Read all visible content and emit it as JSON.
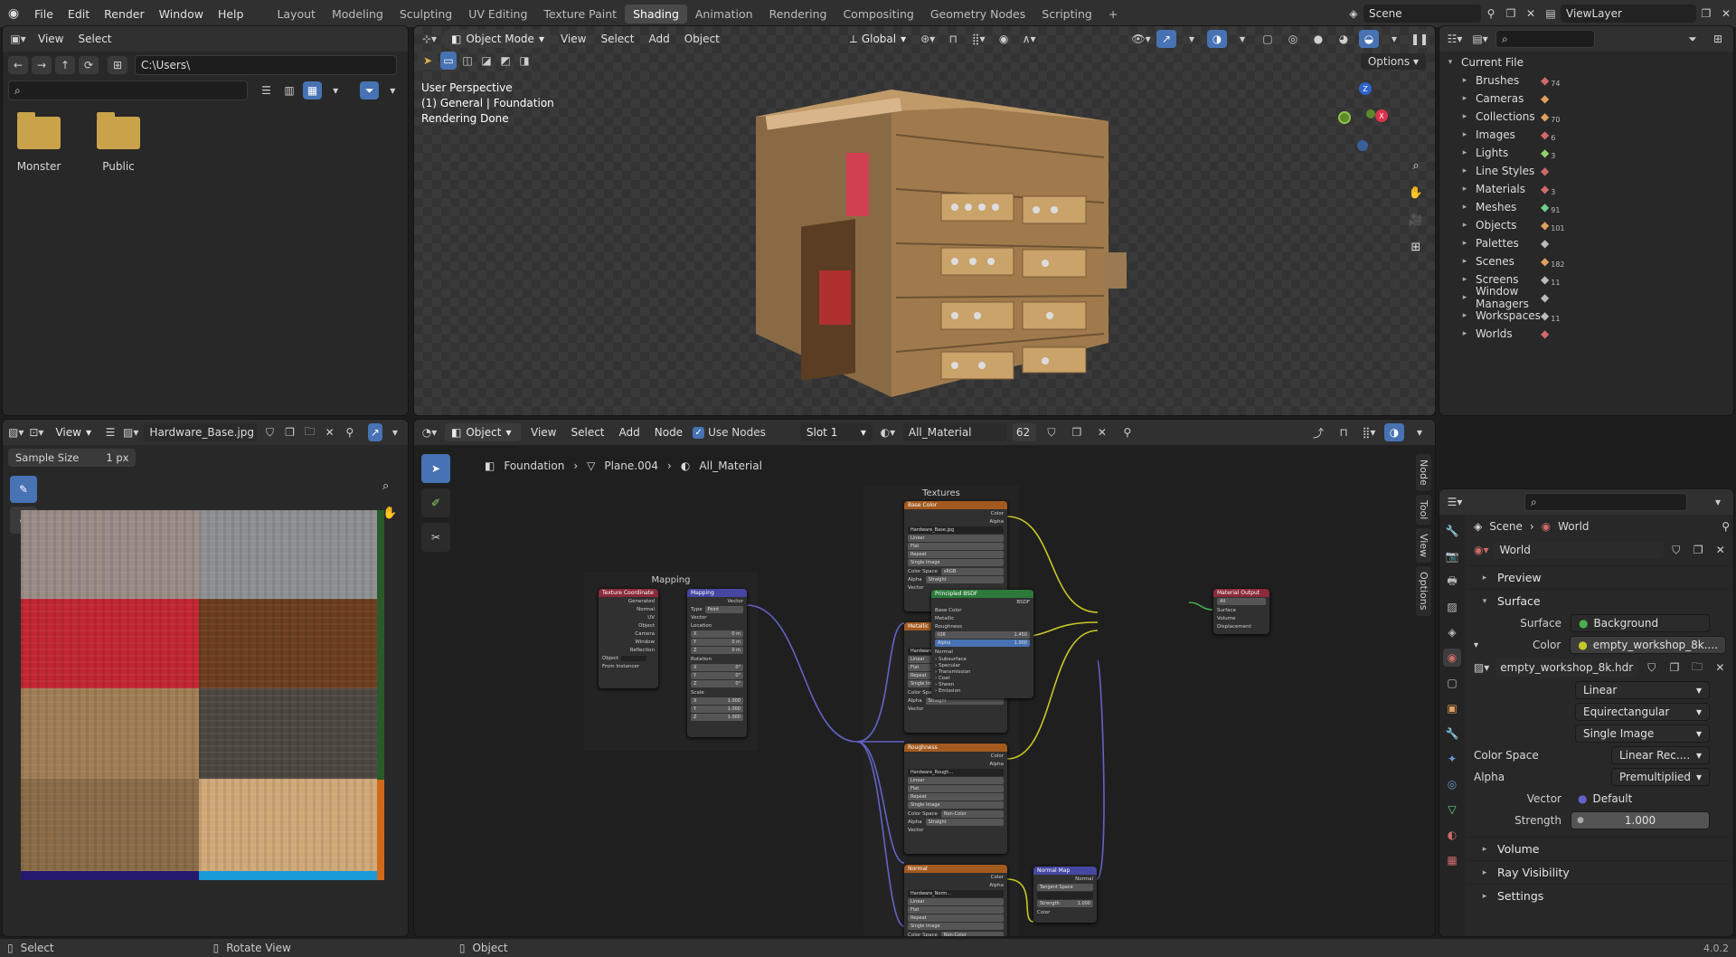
{
  "topbar": {
    "menus": [
      "File",
      "Edit",
      "Render",
      "Window",
      "Help"
    ],
    "workspaces": [
      "Layout",
      "Modeling",
      "Sculpting",
      "UV Editing",
      "Texture Paint",
      "Shading",
      "Animation",
      "Rendering",
      "Compositing",
      "Geometry Nodes",
      "Scripting"
    ],
    "active_workspace": "Shading",
    "add_tab": "+",
    "scene": "Scene",
    "view_layer": "ViewLayer"
  },
  "file_browser": {
    "menus": [
      "View",
      "Select"
    ],
    "path": "C:\\Users\\",
    "search_placeholder": "",
    "folders": [
      "Monster",
      "Public"
    ]
  },
  "viewport": {
    "mode": "Object Mode",
    "menus": [
      "View",
      "Select",
      "Add",
      "Object"
    ],
    "orientation": "Global",
    "options": "Options",
    "overlay_lines": [
      "User Perspective",
      "(1) General | Foundation",
      "Rendering Done"
    ],
    "gizmo": {
      "z": "Z",
      "x": "X"
    }
  },
  "outliner": {
    "root": "Current File",
    "items": [
      {
        "label": "Brushes",
        "count": "74",
        "color": "#d06a6a"
      },
      {
        "label": "Cameras",
        "count": "",
        "color": "#e0a060"
      },
      {
        "label": "Collections",
        "count": "70",
        "color": "#e0a060"
      },
      {
        "label": "Images",
        "count": "6",
        "color": "#d06a6a"
      },
      {
        "label": "Lights",
        "count": "3",
        "color": "#8fd06a"
      },
      {
        "label": "Line Styles",
        "count": "",
        "color": "#d06a6a"
      },
      {
        "label": "Materials",
        "count": "3",
        "color": "#d06a6a"
      },
      {
        "label": "Meshes",
        "count": "91",
        "color": "#6ad08f"
      },
      {
        "label": "Objects",
        "count": "101",
        "color": "#e0a060"
      },
      {
        "label": "Palettes",
        "count": "",
        "color": "#bbb"
      },
      {
        "label": "Scenes",
        "count": "182",
        "color": "#e0a060"
      },
      {
        "label": "Screens",
        "count": "11",
        "color": "#bbb"
      },
      {
        "label": "Window Managers",
        "count": "",
        "color": "#bbb"
      },
      {
        "label": "Workspaces",
        "count": "11",
        "color": "#bbb"
      },
      {
        "label": "Worlds",
        "count": "",
        "color": "#d06a6a"
      }
    ]
  },
  "image_editor": {
    "menu": "View",
    "image_name": "Hardware_Base.jpg",
    "sample_label": "Sample Size",
    "sample_value": "1 px",
    "tiles": [
      "#9a8c86",
      "#8d8f90",
      "#c22633",
      "#6b3e1e",
      "#a07d55",
      "#4d4740",
      "#8a6b48",
      "#cfa877"
    ],
    "bottom_strip": [
      "#231a6e",
      "#1a9bd6"
    ]
  },
  "node_editor": {
    "type": "Object",
    "menus": [
      "View",
      "Select",
      "Add",
      "Node"
    ],
    "use_nodes": "Use Nodes",
    "slot": "Slot 1",
    "material": "All_Material",
    "users": "62",
    "breadcrumb": [
      "Foundation",
      "Plane.004",
      "All_Material"
    ],
    "side_tabs": [
      "Node",
      "Tool",
      "View",
      "Options"
    ],
    "frames": {
      "textures": "Textures",
      "mapping": "Mapping"
    },
    "nodes": {
      "base_color": "Base Color",
      "metallic": "Metallic",
      "roughness": "Roughness",
      "normal": "Normal",
      "tex_coord": "Texture Coordinate",
      "mapping": "Mapping",
      "bsdf": "Principled BSDF",
      "output": "Material Output",
      "normal_map": "Normal Map",
      "base_img": "Hardware_Base.jpg",
      "metal_img": "Hardware_Metal...",
      "rough_img": "Hardware_Rough...",
      "norm_img": "Hardware_Norm...",
      "linear": "Linear",
      "flat": "Flat",
      "repeat": "Repeat",
      "single_image": "Single Image",
      "color_space": "Color Space",
      "srgb": "sRGB",
      "non_color": "Non-Color",
      "alpha": "Alpha",
      "straight": "Straight",
      "vector": "Vector",
      "color": "Color",
      "tex_outputs": [
        "Generated",
        "Normal",
        "UV",
        "Object",
        "Camera",
        "Window",
        "Reflection"
      ],
      "object_label": "Object",
      "from_instancer": "From Instancer",
      "map_type": "Type",
      "map_point": "Point",
      "location": "Location",
      "rotation": "Rotation",
      "scale": "Scale",
      "xyz": [
        "X",
        "Y",
        "Z"
      ],
      "loc_vals": [
        "0 m",
        "0 m",
        "0 m"
      ],
      "rot_vals": [
        "0°",
        "0°",
        "0°"
      ],
      "scale_vals": [
        "1.000",
        "1.000",
        "1.000"
      ],
      "bsdf_label": "BSDF",
      "bsdf_inputs": [
        "Base Color",
        "Metallic",
        "Roughness",
        "IOR",
        "Alpha",
        "Normal"
      ],
      "ior_val": "1.450",
      "alpha_val": "1.000",
      "bsdf_panels": [
        "Subsurface",
        "Specular",
        "Transmission",
        "Coat",
        "Sheen",
        "Emission"
      ],
      "out_all": "All",
      "out_inputs": [
        "Surface",
        "Volume",
        "Displacement"
      ],
      "tangent_space": "Tangent Space",
      "strength": "Strength",
      "strength_val": "1.000",
      "normal_label": "Normal"
    }
  },
  "properties": {
    "breadcrumb": [
      "Scene",
      "World"
    ],
    "world_name": "World",
    "sections": {
      "preview": "Preview",
      "surface": "Surface",
      "volume": "Volume",
      "ray": "Ray Visibility",
      "settings": "Settings"
    },
    "surface_label": "Surface",
    "surface_value": "Background",
    "color_label": "Color",
    "color_value": "empty_workshop_8k....",
    "image_name": "empty_workshop_8k.hdr",
    "interp": "Linear",
    "projection": "Equirectangular",
    "source": "Single Image",
    "color_space_label": "Color Space",
    "color_space_value": "Linear Rec....",
    "alpha_label": "Alpha",
    "alpha_value": "Premultiplied",
    "vector_label": "Vector",
    "vector_value": "Default",
    "strength_label": "Strength",
    "strength_value": "1.000"
  },
  "statusbar": {
    "items": [
      "Select",
      "Rotate View",
      "Object"
    ],
    "version": "4.0.2"
  }
}
